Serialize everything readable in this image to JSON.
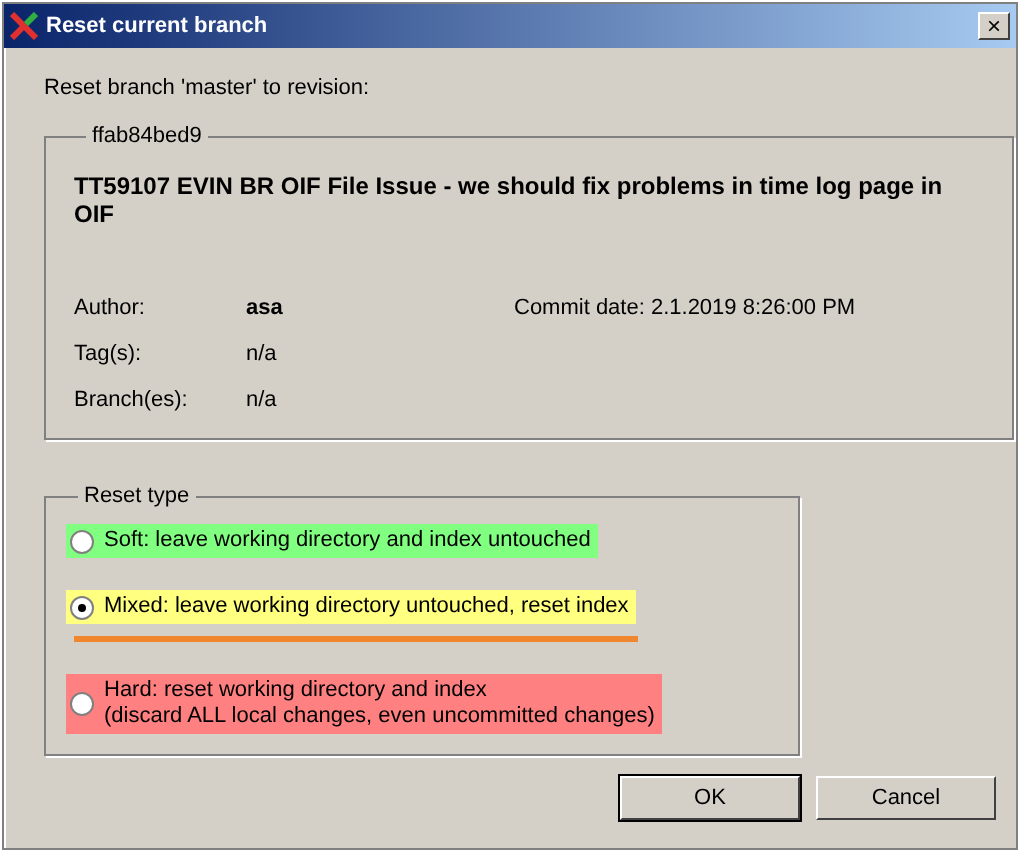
{
  "window": {
    "title": "Reset current branch",
    "close": "×"
  },
  "prompt": "Reset branch 'master' to revision:",
  "commit": {
    "hash": "ffab84bed9",
    "message": "TT59107 EVIN BR OIF File Issue - we should fix problems in time log page in OIF",
    "fields": [
      {
        "label": "Author:",
        "value": "asa",
        "bold": true,
        "extra": "Commit date: 2.1.2019 8:26:00 PM"
      },
      {
        "label": "Tag(s):",
        "value": "n/a",
        "bold": false
      },
      {
        "label": "Branch(es):",
        "value": "n/a",
        "bold": false
      }
    ]
  },
  "reset_type": {
    "title": "Reset type",
    "options": [
      {
        "label": "Soft: leave working directory and index untouched",
        "selected": false,
        "color": "#80ff80",
        "underlined": false
      },
      {
        "label": "Mixed: leave working directory untouched, reset index",
        "selected": true,
        "color": "#ffff80",
        "underlined": true
      },
      {
        "label": "Hard: reset working directory and index",
        "note": "(discard ALL local changes, even uncommitted changes)",
        "selected": false,
        "color": "#ff8080",
        "underlined": false
      }
    ]
  },
  "buttons": [
    {
      "label": "OK",
      "default": true
    },
    {
      "label": "Cancel",
      "default": false
    }
  ]
}
